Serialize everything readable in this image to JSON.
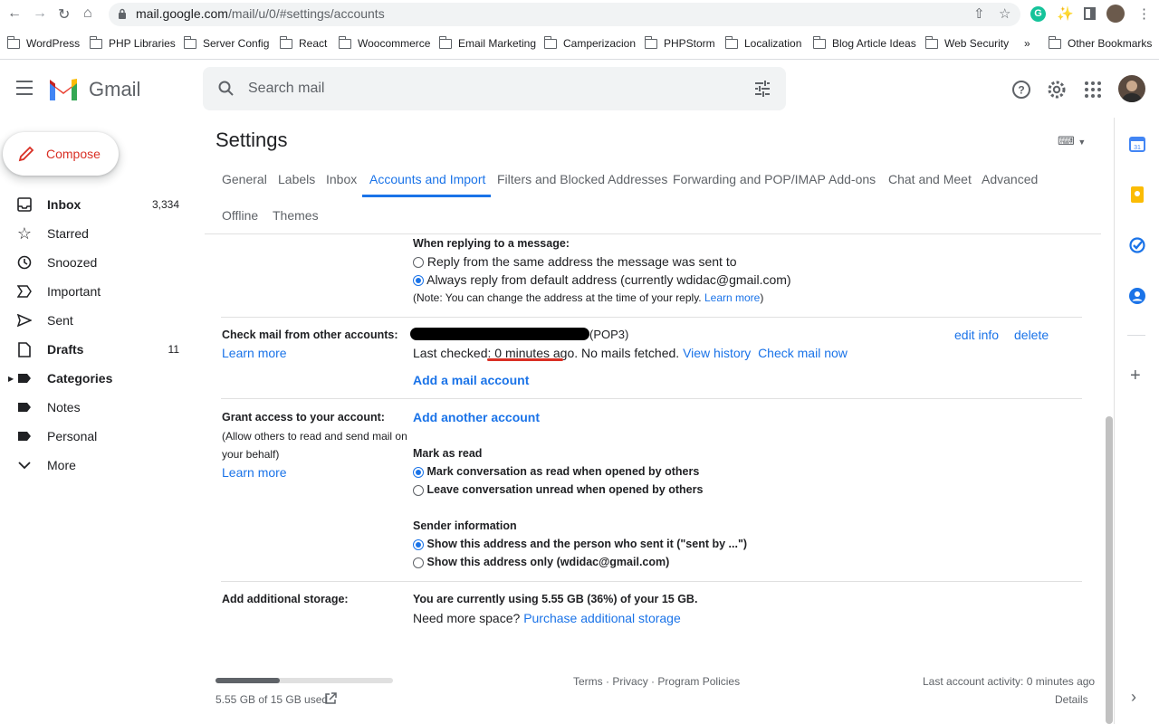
{
  "browser": {
    "url_host": "mail.google.com",
    "url_path": "/mail/u/0/#settings/accounts",
    "bookmarks": [
      "WordPress",
      "PHP Libraries",
      "Server Config",
      "React",
      "Woocommerce",
      "Email Marketing",
      "Camperizacion",
      "PHPStorm",
      "Localization",
      "Blog Article Ideas",
      "Web Security"
    ],
    "overflow": "»",
    "other_bookmarks": "Other Bookmarks"
  },
  "header": {
    "app_name": "Gmail",
    "search_placeholder": "Search mail"
  },
  "sidebar": {
    "compose": "Compose",
    "items": [
      {
        "label": "Inbox",
        "count": "3,334"
      },
      {
        "label": "Starred",
        "count": ""
      },
      {
        "label": "Snoozed",
        "count": ""
      },
      {
        "label": "Important",
        "count": ""
      },
      {
        "label": "Sent",
        "count": ""
      },
      {
        "label": "Drafts",
        "count": "11"
      },
      {
        "label": "Categories",
        "count": ""
      },
      {
        "label": "Notes",
        "count": ""
      },
      {
        "label": "Personal",
        "count": ""
      },
      {
        "label": "More",
        "count": ""
      }
    ]
  },
  "settings": {
    "title": "Settings",
    "tabs": [
      "General",
      "Labels",
      "Inbox",
      "Accounts and Import",
      "Filters and Blocked Addresses",
      "Forwarding and POP/IMAP",
      "Add-ons",
      "Chat and Meet",
      "Advanced",
      "Offline",
      "Themes"
    ],
    "active_tab": "Accounts and Import",
    "reply": {
      "heading": "When replying to a message:",
      "opt1": "Reply from the same address the message was sent to",
      "opt2": "Always reply from default address (currently wdidac@gmail.com)",
      "note": "(Note: You can change the address at the time of your reply.",
      "note_link": "Learn more",
      "note_end": ")"
    },
    "check_mail": {
      "label": "Check mail from other accounts:",
      "learn_more": "Learn more",
      "protocol": "(POP3)",
      "last_checked_prefix": "Last checked: ",
      "last_checked_value": "0 minutes ago",
      "last_checked_suffix": ". No mails fetched.",
      "view_history": "View history",
      "check_now": "Check mail now",
      "add_account": "Add a mail account",
      "edit_info": "edit info",
      "delete": "delete"
    },
    "grant": {
      "label": "Grant access to your account:",
      "sub1": "(Allow others to read and send mail on",
      "sub2": "your behalf)",
      "learn_more": "Learn more",
      "add_another": "Add another account",
      "mark_heading": "Mark as read",
      "mark_opt1": "Mark conversation as read when opened by others",
      "mark_opt2": "Leave conversation unread when opened by others",
      "sender_heading": "Sender information",
      "sender_opt1": "Show this address and the person who sent it (\"sent by ...\")",
      "sender_opt2": "Show this address only (wdidac@gmail.com)"
    },
    "storage": {
      "label": "Add additional storage:",
      "usage": "You are currently using 5.55 GB (36%) of your 15 GB.",
      "need_more": "Need more space?",
      "purchase": "Purchase additional storage",
      "used_fraction": 0.36
    }
  },
  "footer": {
    "storage_text": "5.55 GB of 15 GB used",
    "terms": "Terms",
    "privacy": "Privacy",
    "policies": "Program Policies",
    "sep": "·",
    "last_activity": "Last account activity: 0 minutes ago",
    "details": "Details"
  },
  "colors": {
    "link": "#1a73e8",
    "compose_text": "#d93025",
    "underline_annotation": "#d93025"
  }
}
